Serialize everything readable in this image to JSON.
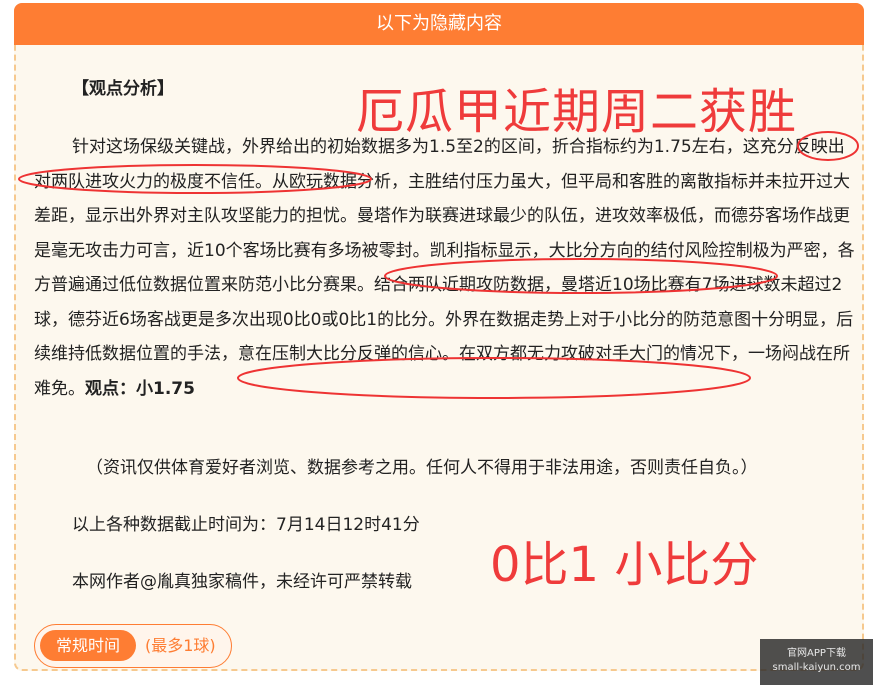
{
  "header": {
    "title": "以下为隐藏内容"
  },
  "content": {
    "section_title": "【观点分析】",
    "paragraph_1": "针对这场保级关键战，外界给出的初始数据多为1.5至2的区间，折合指标约为1.75左右，这充分反映出对两队进攻火力的极度不信任。从欧玩数据分析，主胜结付压力虽大，但平局和客胜的离散指标并未拉开过大差距，显示出外界对主队攻坚能力的担忧。曼塔作为联赛进球最少的队伍，进攻效率极低，而德芬客场作战更是毫无攻击力可言，近10个客场比赛有多场被零封。凯利指标显示，大比分方向的结付风险控制极为严密，各方普遍通过低位数据位置来防范小比分赛果。结合两队近期攻防数据，曼塔近10场比赛有7场进球数未超过2球，德芬近6场客战更是多次出现0比0或0比1的比分。外界在数据走势上对于小比分的防范意图十分明显，后续维持低数据位置的手法，意在压制大比分反弹的信心。在双方都无力攻破对手大门的情况下，一场闷战在所难免。",
    "verdict": "观点：小1.75",
    "disclaimer": "（资讯仅供体育爱好者浏览、数据参考之用。任何人不得用于非法用途，否则责任自负。）",
    "deadline": "以上各种数据截止时间为：7月14日12时41分",
    "author": "本网作者@胤真独家稿件，未经许可严禁转载"
  },
  "overlays": {
    "headline": "厄瓜甲近期周二获胜",
    "score": "0比1 小比分"
  },
  "tag": {
    "label": "常规时间",
    "note": "(最多1球)"
  },
  "watermark": {
    "line1": "官网APP下载",
    "line2": "small-kaiyun.com"
  },
  "colors": {
    "accent": "#fe7d33",
    "overlay_red": "#ef3b3b",
    "card_bg": "#fdf8ee",
    "card_border": "#f6c98f"
  }
}
